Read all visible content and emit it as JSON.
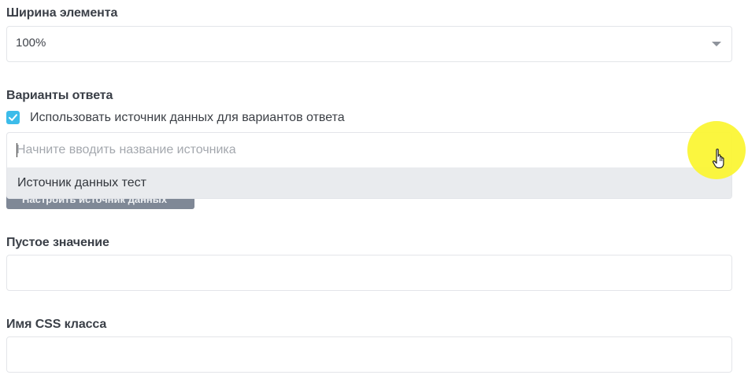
{
  "width_field": {
    "label": "Ширина элемента",
    "value": "100%"
  },
  "answer_options": {
    "label": "Варианты ответа",
    "use_datasource_checkbox": {
      "label": "Использовать источник данных для вариантов ответа",
      "checked": true
    },
    "datasource_search": {
      "placeholder": "Начните вводить название источника",
      "value": ""
    },
    "dropdown_items": [
      "Источник данных тест"
    ],
    "obscured_button_label": "Настроить источник данных"
  },
  "empty_value_field": {
    "label": "Пустое значение",
    "value": ""
  },
  "css_class_field": {
    "label": "Имя CSS класса",
    "value": ""
  },
  "colors": {
    "accent": "#3cbcea",
    "cursor_highlight": "#fbf635",
    "dropdown_hover": "#e9ebee"
  },
  "icons": {
    "caret": "chevron-down-icon",
    "check": "check-icon",
    "pointer": "hand-pointer-icon"
  }
}
